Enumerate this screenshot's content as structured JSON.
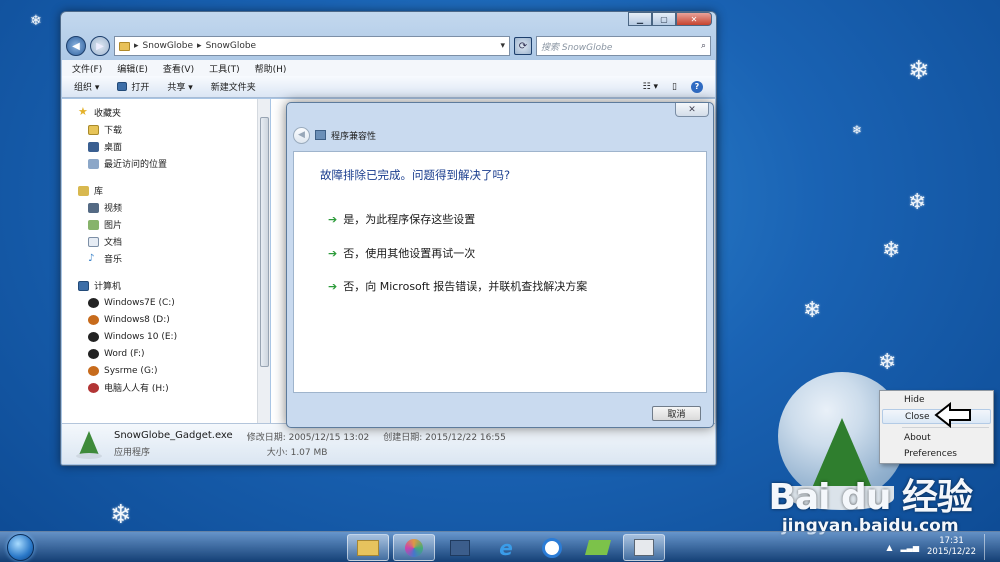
{
  "explorer": {
    "address": [
      "SnowGlobe",
      "SnowGlobe"
    ],
    "search_placeholder": "搜索 SnowGlobe",
    "menu": [
      "文件(F)",
      "编辑(E)",
      "查看(V)",
      "工具(T)",
      "帮助(H)"
    ],
    "toolbar": {
      "organize": "组织 ▾",
      "open": "打开",
      "share": "共享 ▾",
      "new_folder": "新建文件夹"
    },
    "nav": {
      "favorites": "收藏夹",
      "favorites_items": [
        "下载",
        "桌面",
        "最近访问的位置"
      ],
      "libraries": "库",
      "libraries_items": [
        "视频",
        "图片",
        "文档",
        "音乐"
      ],
      "computer": "计算机",
      "drives": [
        "Windows7E (C:)",
        "Windows8 (D:)",
        "Windows 10 (E:)",
        "Word (F:)",
        "Sysrme (G:)",
        "电脑人人有 (H:)"
      ]
    },
    "details": {
      "file_name": "SnowGlobe_Gadget.exe",
      "file_type": "应用程序",
      "modified_label": "修改日期: 2005/12/15 13:02",
      "created_label": "创建日期: 2015/12/22 16:55",
      "size_label": "大小: 1.07 MB"
    }
  },
  "dialog": {
    "title": "程序兼容性",
    "question": "故障排除已完成。问题得到解决了吗?",
    "options": [
      "是，为此程序保存这些设置",
      "否，使用其他设置再试一次",
      "否，向 Microsoft 报告错误，并联机查找解决方案"
    ],
    "cancel": "取消"
  },
  "context_menu": {
    "items": [
      "Hide",
      "Close",
      "About",
      "Preferences"
    ],
    "highlighted": "Close"
  },
  "watermark": {
    "logo": "Bai du 经验",
    "url": "jingyan.baidu.com"
  },
  "taskbar": {
    "time": "17:31",
    "date": "2015/12/22"
  },
  "colors": {
    "desktop": "#1a63b4",
    "question_text": "#1a3d8e",
    "arrow": "#2c9b3a"
  }
}
